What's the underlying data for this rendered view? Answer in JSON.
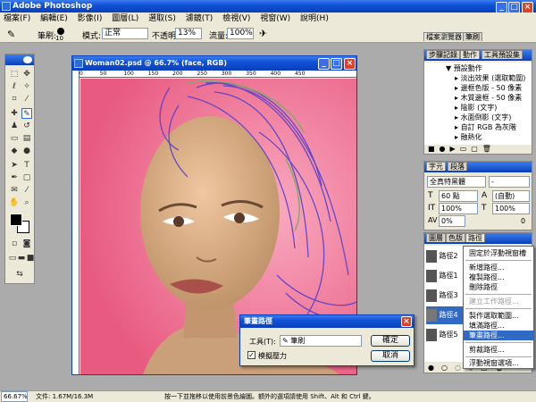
{
  "app": {
    "title": "Adobe Photoshop"
  },
  "menubar": [
    "檔案(F)",
    "編輯(E)",
    "影像(I)",
    "圖層(L)",
    "選取(S)",
    "濾鏡(T)",
    "檢視(V)",
    "視窗(W)",
    "說明(H)"
  ],
  "options": {
    "brush_label": "筆刷:",
    "brush_size": "10",
    "mode_label": "模式:",
    "mode_value": "正常",
    "opacity_label": "不透明:",
    "opacity_value": "13%",
    "flow_label": "流量:",
    "flow_value": "100%"
  },
  "palette_well": {
    "tab1": "檔案瀏覽器",
    "tab2": "筆刷"
  },
  "document": {
    "title": "Woman02.psd @ 66.7% (face, RGB)",
    "ruler_marks": [
      "0",
      "50",
      "100",
      "150",
      "200",
      "250",
      "300",
      "350",
      "400",
      "450",
      "500"
    ]
  },
  "actions_panel": {
    "tabs": [
      "步驟記錄",
      "動作",
      "工具預設集"
    ],
    "items": [
      "預設動作",
      "淡出效果 (選取範圍)",
      "邊框色版 - 50 像素",
      "木質邊框 - 50 像素",
      "陰影 (文字)",
      "水面倒影 (文字)",
      "自訂 RGB 為灰階",
      "融熱化"
    ]
  },
  "character_panel": {
    "tabs": [
      "字元",
      "段落"
    ],
    "font": "全真特黑體",
    "style": "-",
    "size": "60 點",
    "leading": "(自動)",
    "scale_v": "100%",
    "scale_h": "100%",
    "tracking": "0%",
    "baseline": "0"
  },
  "paths_panel": {
    "tabs": [
      "圖層",
      "色版",
      "路徑"
    ],
    "items": [
      "路徑2",
      "路徑1",
      "路徑3",
      "路徑4",
      "路徑5"
    ]
  },
  "context_menu": {
    "items": [
      "固定於浮動視窗槽",
      "新增路徑...",
      "複製路徑...",
      "刪除路徑",
      "建立工作路徑...",
      "製作選取範圍...",
      "填滿路徑...",
      "筆畫路徑...",
      "剪裁路徑...",
      "浮動視窗選項..."
    ],
    "selected": "筆畫路徑..."
  },
  "stroke_dialog": {
    "title": "筆畫路徑",
    "tool_label": "工具(T):",
    "tool_value": "筆刷",
    "simulate_label": "模擬壓力",
    "ok": "確定",
    "cancel": "取消"
  },
  "statusbar": {
    "zoom": "66.67%",
    "doc": "文件: 1.67M/16.3M",
    "hint": "按一下並拖移以使用前景色繪圖。額外的選項請使用 Shift、Alt 和 Ctrl 鍵。"
  },
  "colors": {
    "canvas_pink": "#f07a98",
    "xp_blue": "#0a3fb8",
    "highlight": "#316ac5"
  }
}
